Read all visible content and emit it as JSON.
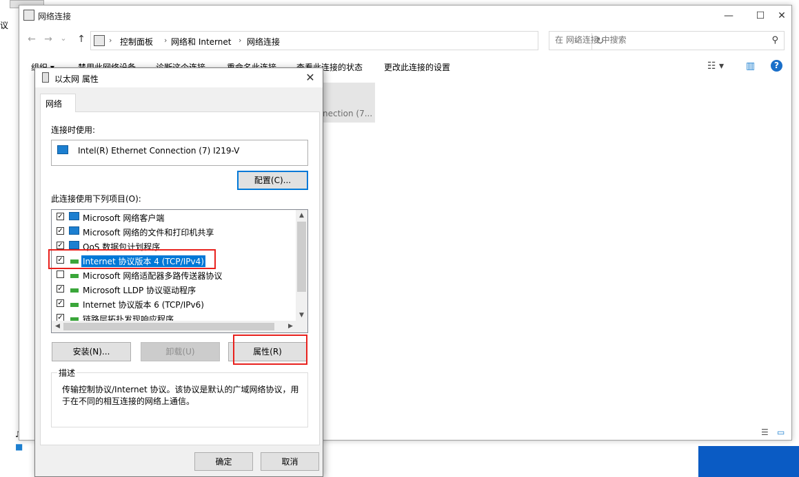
{
  "background": {
    "left_fragment_text": "议",
    "taskbar_items": [
      "♪",
      "■"
    ]
  },
  "explorer": {
    "title": "网络连接",
    "nav": {
      "back": "←",
      "forward": "→",
      "history": "⌄",
      "up": "↑"
    },
    "breadcrumbs": [
      "控制面板",
      "网络和 Internet",
      "网络连接"
    ],
    "search_placeholder": "在 网络连接 中搜索",
    "toolbar": [
      "组织 ▾",
      "禁用此网络设备",
      "诊断这个连接",
      "重命名此连接",
      "查看此连接的状态",
      "更改此连接的设置"
    ],
    "network_item_partial": "nection (7..."
  },
  "dialog": {
    "title": "以太网 属性",
    "tab": "网络",
    "connect_using_label": "连接时使用:",
    "adapter_name": "Intel(R) Ethernet Connection (7) I219-V",
    "configure_button": "配置(C)...",
    "items_label": "此连接使用下列项目(O):",
    "items": [
      {
        "label": "Microsoft 网络客户端",
        "checked": true,
        "icon": "computer-icon"
      },
      {
        "label": "Microsoft 网络的文件和打印机共享",
        "checked": true,
        "icon": "computer-icon"
      },
      {
        "label": "QoS 数据包计划程序",
        "checked": true,
        "icon": "computer-icon"
      },
      {
        "label": "Internet 协议版本 4 (TCP/IPv4)",
        "checked": true,
        "icon": "protocol-icon",
        "selected": true
      },
      {
        "label": "Microsoft 网络适配器多路传送器协议",
        "checked": false,
        "icon": "protocol-icon"
      },
      {
        "label": "Microsoft LLDP 协议驱动程序",
        "checked": true,
        "icon": "protocol-icon"
      },
      {
        "label": "Internet 协议版本 6 (TCP/IPv6)",
        "checked": true,
        "icon": "protocol-icon"
      },
      {
        "label": "链路层拓扑发现响应程序",
        "checked": true,
        "icon": "protocol-icon"
      }
    ],
    "install_button": "安装(N)...",
    "uninstall_button": "卸载(U)",
    "properties_button": "属性(R)",
    "description_label": "描述",
    "description_text": "传输控制协议/Internet 协议。该协议是默认的广域网络协议，用于在不同的相互连接的网络上通信。",
    "ok_button": "确定",
    "cancel_button": "取消"
  },
  "accent_colors": {
    "selection": "#0078d7",
    "highlight_box": "#e8201c"
  }
}
